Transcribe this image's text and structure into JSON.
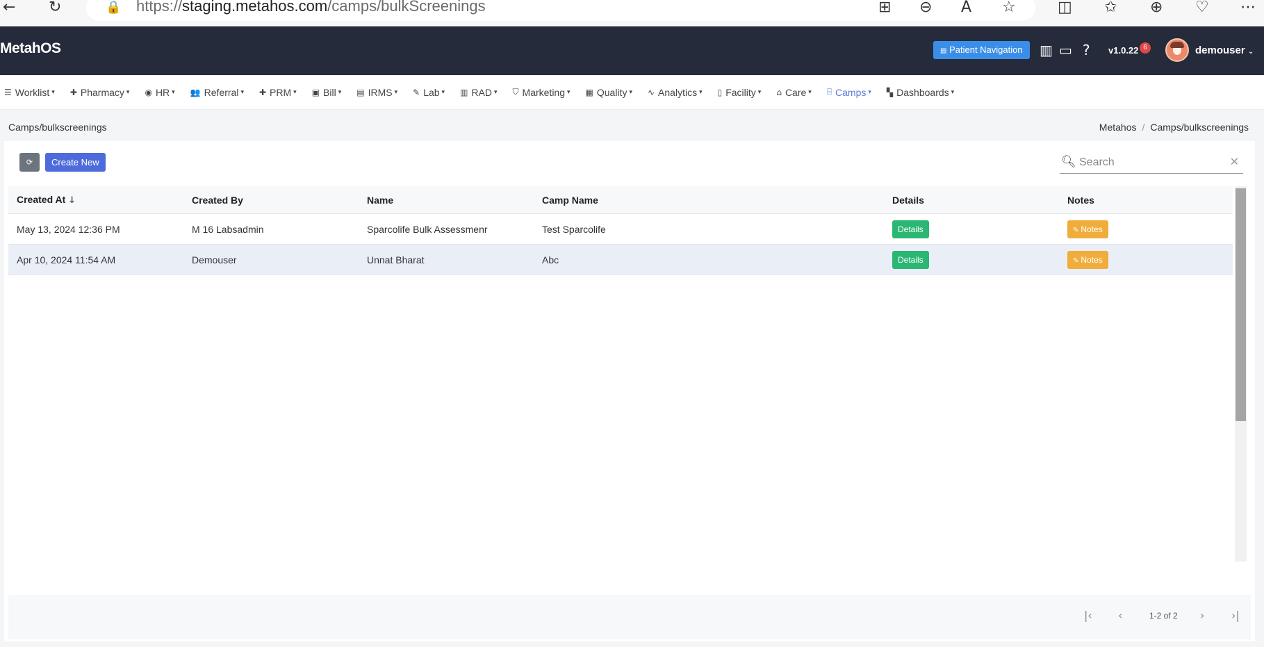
{
  "browser": {
    "url_prefix": "https://",
    "url_domain": "staging.metahos.com",
    "url_path": "/camps/bulkScreenings"
  },
  "header": {
    "brand": "MetahOS",
    "patient_nav_label": "Patient Navigation",
    "version": "v1.0.22",
    "notification_count": "6",
    "username": "demouser"
  },
  "nav": {
    "items": [
      {
        "label": "Worklist",
        "icon": "list-icon",
        "glyph": "☰"
      },
      {
        "label": "Pharmacy",
        "icon": "plus-icon",
        "glyph": "✚"
      },
      {
        "label": "HR",
        "icon": "user-circle-icon",
        "glyph": "◉"
      },
      {
        "label": "Referral",
        "icon": "users-icon",
        "glyph": "👥"
      },
      {
        "label": "PRM",
        "icon": "plus-icon",
        "glyph": "✚"
      },
      {
        "label": "Bill",
        "icon": "bill-icon",
        "glyph": "▣"
      },
      {
        "label": "IRMS",
        "icon": "irms-icon",
        "glyph": "▤"
      },
      {
        "label": "Lab",
        "icon": "pen-icon",
        "glyph": "✎"
      },
      {
        "label": "RAD",
        "icon": "film-icon",
        "glyph": "▥"
      },
      {
        "label": "Marketing",
        "icon": "bag-icon",
        "glyph": "⛉"
      },
      {
        "label": "Quality",
        "icon": "quality-icon",
        "glyph": "▦"
      },
      {
        "label": "Analytics",
        "icon": "pulse-icon",
        "glyph": "∿"
      },
      {
        "label": "Facility",
        "icon": "building-icon",
        "glyph": "▯"
      },
      {
        "label": "Care",
        "icon": "bed-icon",
        "glyph": "⌂"
      },
      {
        "label": "Camps",
        "icon": "briefcase-icon",
        "glyph": "⌸",
        "active": true
      },
      {
        "label": "Dashboards",
        "icon": "grid-icon",
        "glyph": "▚"
      }
    ]
  },
  "page": {
    "title": "Camps/bulkscreenings",
    "breadcrumb": [
      "Metahos",
      "Camps/bulkscreenings"
    ]
  },
  "toolbar": {
    "create_label": "Create New",
    "search_placeholder": "Search"
  },
  "table": {
    "columns": [
      "Created At",
      "Created By",
      "Name",
      "Camp Name",
      "Details",
      "Notes"
    ],
    "rows": [
      {
        "created_at": "May 13, 2024 12:36 PM",
        "created_by": "M 16 Labsadmin",
        "name": "Sparcolife Bulk Assessmenr",
        "camp_name": "Test Sparcolife",
        "details": "Details",
        "notes": "Notes"
      },
      {
        "created_at": "Apr 10, 2024 11:54 AM",
        "created_by": "Demouser",
        "name": "Unnat Bharat",
        "camp_name": "Abc",
        "details": "Details",
        "notes": "Notes"
      }
    ]
  },
  "pagination": {
    "info": "1-2 of 2"
  },
  "colors": {
    "header_bg": "#252b3b",
    "primary": "#4e6bdc",
    "details": "#2bb673",
    "notes": "#f0ad3c",
    "active_nav": "#5a7bd6"
  }
}
